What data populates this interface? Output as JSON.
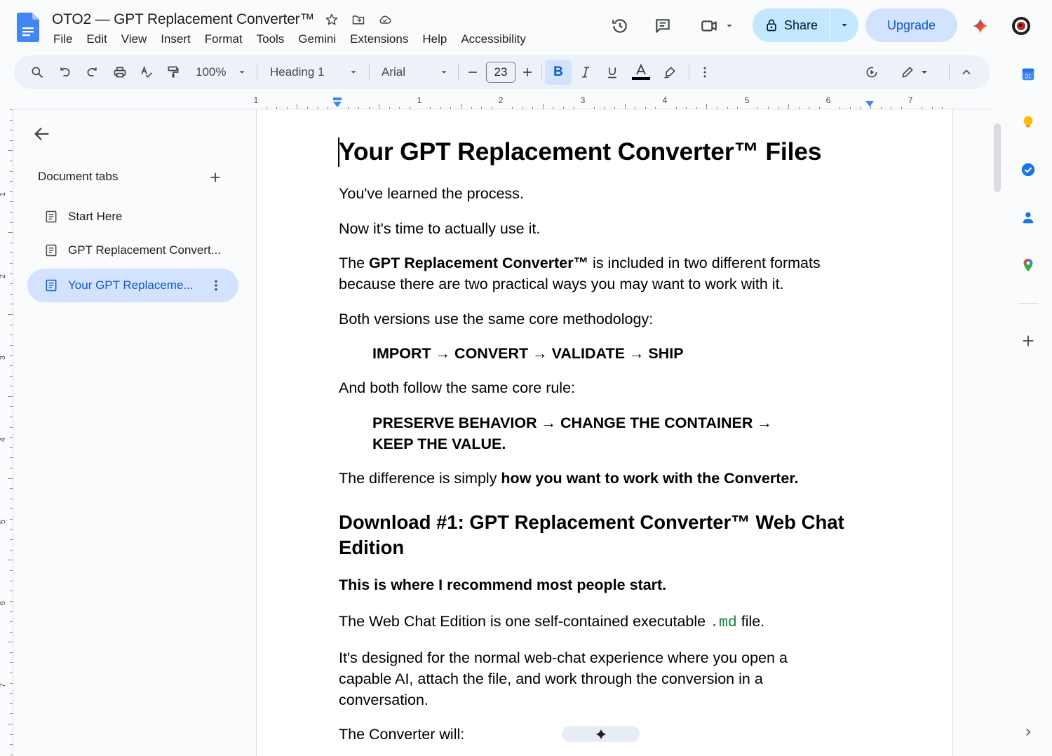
{
  "title_bar": {
    "doc_title": "OTO2 — GPT Replacement Converter™",
    "menu": [
      "File",
      "Edit",
      "View",
      "Insert",
      "Format",
      "Tools",
      "Gemini",
      "Extensions",
      "Help",
      "Accessibility"
    ],
    "share_label": "Share",
    "upgrade_label": "Upgrade"
  },
  "toolbar": {
    "zoom": "100%",
    "style": "Heading 1",
    "font": "Arial",
    "font_size": "23",
    "bold_label": "B"
  },
  "ruler": {
    "labels": [
      "1",
      "1",
      "2",
      "3",
      "4",
      "5",
      "6",
      "7"
    ]
  },
  "vertical_ruler": {
    "labels": [
      "1",
      "2",
      "3",
      "4",
      "5",
      "6",
      "7"
    ]
  },
  "sidebar": {
    "heading": "Document tabs",
    "tabs": [
      {
        "label": "Start Here"
      },
      {
        "label": "GPT Replacement Convert..."
      },
      {
        "label": "Your GPT Replaceme..."
      }
    ]
  },
  "document": {
    "title": "Your GPT Replacement Converter™ Files",
    "p1": "You've learned the process.",
    "p2": "Now it's time to actually use it.",
    "p3a": "The ",
    "p3b": "GPT Replacement Converter™",
    "p3c": " is included in two different formats",
    "p3d": "because there are two practical ways you may want to work with it.",
    "p4": "Both versions use the same core methodology:",
    "method": "IMPORT → CONVERT → VALIDATE → SHIP",
    "p5": "And both follow the same core rule:",
    "rule1": "PRESERVE BEHAVIOR → CHANGE THE CONTAINER →",
    "rule2": "KEEP THE VALUE.",
    "p6a": "The difference is simply ",
    "p6b": "how you want to work with the Converter.",
    "h2a": "Download #1: GPT Replacement Converter™ Web Chat",
    "h2b": "Edition",
    "p7": "This is where I recommend most people start.",
    "p8a": "The Web Chat Edition is one self-contained executable ",
    "p8code": ".md",
    "p8b": " file.",
    "p9a": "It's designed for the normal web-chat experience where you open a",
    "p9b": "capable AI, attach the file, and work through the conversion in a",
    "p9c": "conversation.",
    "p10": "The Converter will:"
  },
  "colors": {
    "accent": "#0b57d0",
    "share_bg": "#c2e7ff",
    "upgrade_bg": "#d3e3fd",
    "toolbar_bg": "#edf2fa",
    "code_green": "#188038"
  }
}
